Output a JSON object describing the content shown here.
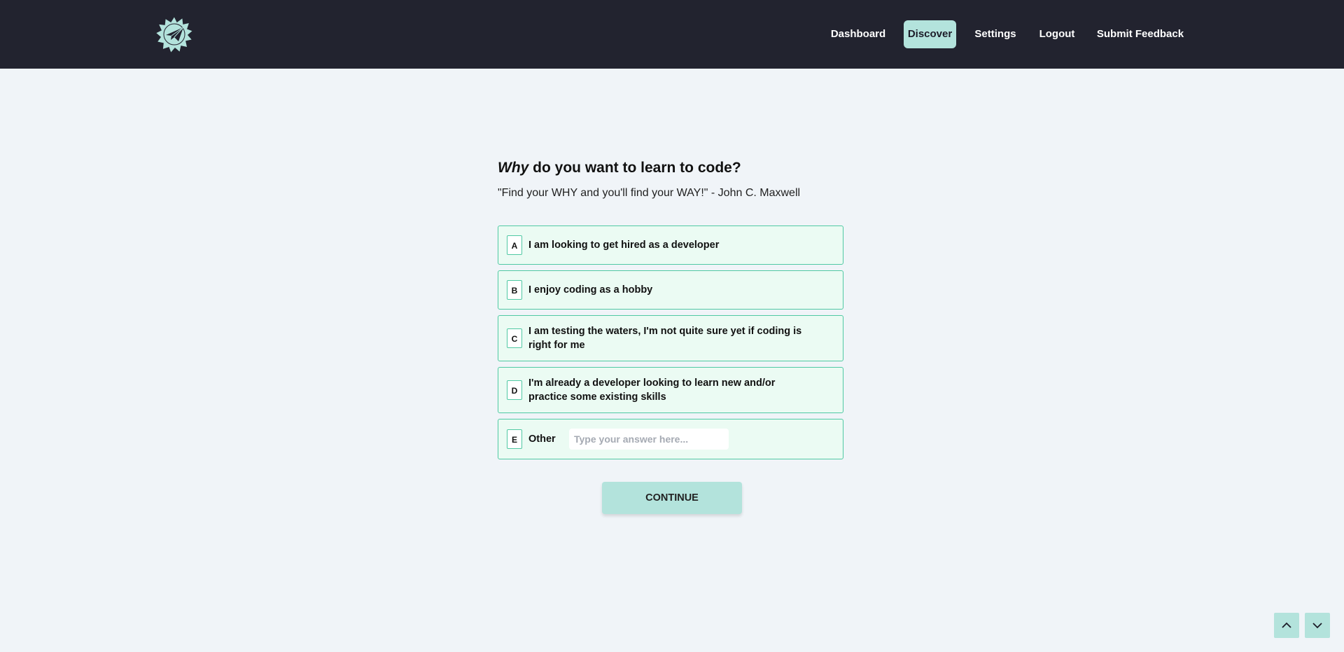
{
  "nav": {
    "logo_icon": "paper-plane-badge-icon",
    "items": [
      {
        "label": "Dashboard",
        "active": false
      },
      {
        "label": "Discover",
        "active": true
      },
      {
        "label": "Settings",
        "active": false
      },
      {
        "label": "Logout",
        "active": false
      },
      {
        "label": "Submit Feedback",
        "active": false
      }
    ]
  },
  "question": {
    "emphasis": "Why",
    "rest": " do you want to learn to code?",
    "quote": "\"Find your WHY and you'll find your WAY!\" - John C. Maxwell"
  },
  "options": [
    {
      "key": "A",
      "text": "I am looking to get hired as a developer"
    },
    {
      "key": "B",
      "text": "I enjoy coding as a hobby"
    },
    {
      "key": "C",
      "text": "I am testing the waters, I'm not quite sure yet if coding is right for me"
    },
    {
      "key": "D",
      "text": "I'm already a developer looking to learn new and/or practice some existing skills"
    },
    {
      "key": "E",
      "text": "Other",
      "input_placeholder": "Type your answer here...",
      "input_value": ""
    }
  ],
  "continue_label": "CONTINUE",
  "scroll": {
    "up_icon": "chevron-up-icon",
    "down_icon": "chevron-down-icon"
  },
  "colors": {
    "header_bg": "#22232f",
    "accent": "#b3e3dc",
    "option_bg": "#ebfbf3",
    "option_border": "#50c9a3",
    "page_bg": "#f0f4f8"
  }
}
